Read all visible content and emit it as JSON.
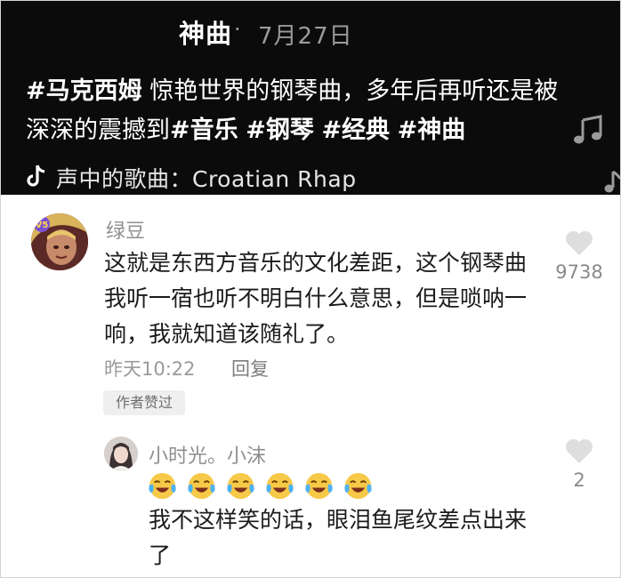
{
  "header": {
    "title_partial": "神曲",
    "separator": "·",
    "date": "7月27日",
    "caption": {
      "tag1": "#马克西姆",
      "text1": "惊艳世界的钢琴曲，多年后再听还是被深深的震撼到",
      "tag2": "#音乐",
      "tag3": "#钢琴",
      "tag4": "#经典",
      "tag5": "#神曲"
    },
    "song_line": "声中的歌曲：Croatian Rhap"
  },
  "comments": [
    {
      "username": "绿豆",
      "text": "这就是东西方音乐的文化差距，这个钢琴曲我听一宿也听不明白什么意思，但是唢呐一响，我就知道该随礼了。",
      "time": "昨天10:22",
      "reply_label": "回复",
      "badge": "作者赞过",
      "likes": "9738",
      "avatar_icon": "game-character-avatar",
      "avatar_badge": "V5"
    },
    {
      "username": "小时光。小沫",
      "emoji_name": "laughing-crying-emoji",
      "emoji_count": 6,
      "text": "我不这样笑的话，眼泪鱼尾纹差点出来了",
      "likes": "2",
      "avatar_icon": "girl-avatar"
    }
  ],
  "colors": {
    "header_bg": "#0b0b0b",
    "header_text": "#ffffff",
    "muted_text": "#9a9a9a",
    "body_text": "#1b1b1b",
    "badge_bg": "#efefef"
  }
}
